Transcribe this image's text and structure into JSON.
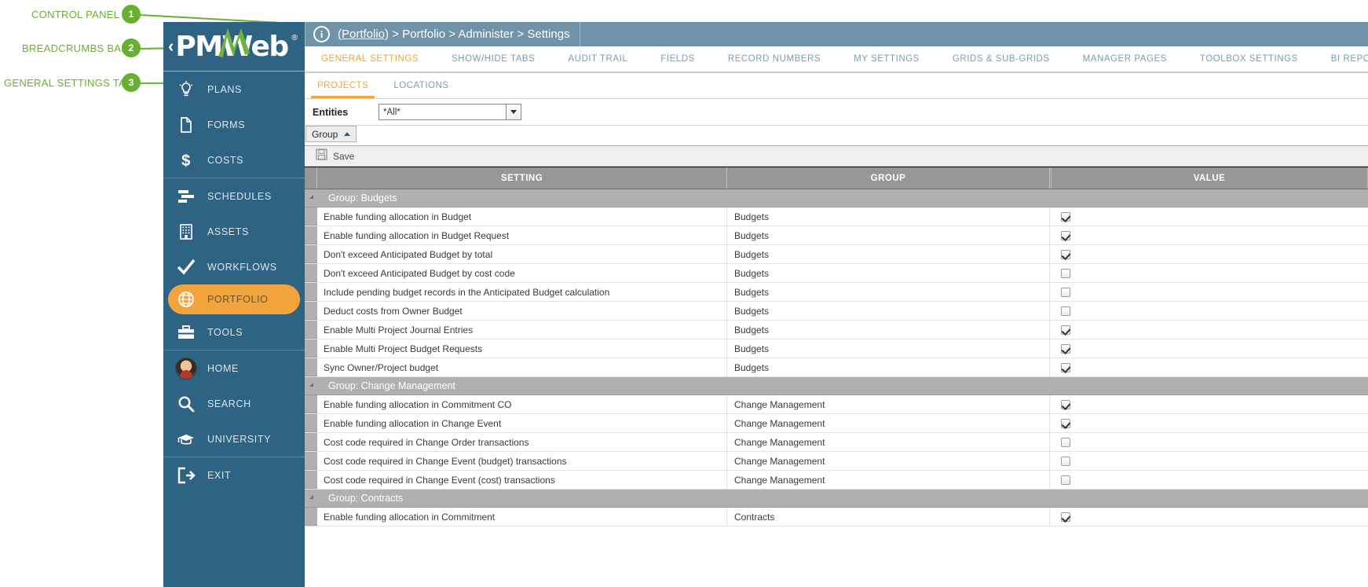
{
  "annotations": [
    {
      "num": "1",
      "label": "CONTROL PANEL"
    },
    {
      "num": "2",
      "label": "BREADCRUMBS BAR"
    },
    {
      "num": "3",
      "label": "GENERAL SETTINGS TAB"
    }
  ],
  "colors": {
    "sidebar": "#2f6384",
    "accent": "#f2a33c",
    "topbar": "#6f93a8",
    "annotation": "#68b130",
    "grid_header": "#979797",
    "group_row": "#b0b0b0"
  },
  "sidebar": {
    "logo": {
      "text": "PMWeb",
      "chevron": "‹",
      "registered": "®"
    },
    "groups": [
      {
        "items": [
          {
            "label": "PLANS",
            "icon": "lightbulb-icon",
            "active": false
          },
          {
            "label": "FORMS",
            "icon": "document-icon",
            "active": false
          },
          {
            "label": "COSTS",
            "icon": "dollar-icon",
            "active": false
          }
        ]
      },
      {
        "items": [
          {
            "label": "SCHEDULES",
            "icon": "gantt-icon",
            "active": false
          },
          {
            "label": "ASSETS",
            "icon": "building-icon",
            "active": false
          },
          {
            "label": "WORKFLOWS",
            "icon": "checkmark-icon",
            "active": false
          },
          {
            "label": "PORTFOLIO",
            "icon": "globe-icon",
            "active": true
          },
          {
            "label": "TOOLS",
            "icon": "toolbox-icon",
            "active": false
          }
        ]
      },
      {
        "items": [
          {
            "label": "HOME",
            "icon": "avatar-icon",
            "active": false
          },
          {
            "label": "SEARCH",
            "icon": "search-icon",
            "active": false
          },
          {
            "label": "UNIVERSITY",
            "icon": "graduation-cap-icon",
            "active": false
          }
        ]
      },
      {
        "items": [
          {
            "label": "EXIT",
            "icon": "exit-icon",
            "active": false
          }
        ]
      }
    ]
  },
  "header": {
    "info_icon": "i",
    "breadcrumb_link": "(Portfolio)",
    "breadcrumb_rest": " > Portfolio > Administer > Settings"
  },
  "tabs": [
    {
      "label": "GENERAL SETTINGS",
      "active": true
    },
    {
      "label": "SHOW/HIDE TABS",
      "active": false
    },
    {
      "label": "AUDIT TRAIL",
      "active": false
    },
    {
      "label": "FIELDS",
      "active": false
    },
    {
      "label": "RECORD NUMBERS",
      "active": false
    },
    {
      "label": "MY SETTINGS",
      "active": false
    },
    {
      "label": "GRIDS & SUB-GRIDS",
      "active": false
    },
    {
      "label": "MANAGER PAGES",
      "active": false
    },
    {
      "label": "TOOLBOX SETTINGS",
      "active": false
    },
    {
      "label": "BI REPORTING",
      "active": false
    }
  ],
  "subtabs": [
    {
      "label": "PROJECTS",
      "active": true
    },
    {
      "label": "LOCATIONS",
      "active": false
    }
  ],
  "filter": {
    "entities_label": "Entities",
    "entities_value": "*All*",
    "entities_placeholder": "*All*"
  },
  "group_button": {
    "label": "Group"
  },
  "toolbar": {
    "save_label": "Save",
    "save_icon": "save-disk-icon"
  },
  "grid": {
    "columns": [
      "SETTING",
      "GROUP",
      "VALUE"
    ],
    "groups": [
      {
        "title": "Group: Budgets",
        "rows": [
          {
            "setting": "Enable funding allocation in Budget",
            "group": "Budgets",
            "value": true
          },
          {
            "setting": "Enable funding allocation in Budget Request",
            "group": "Budgets",
            "value": true
          },
          {
            "setting": "Don't exceed Anticipated Budget by total",
            "group": "Budgets",
            "value": true
          },
          {
            "setting": "Don't exceed Anticipated Budget by cost code",
            "group": "Budgets",
            "value": false
          },
          {
            "setting": "Include pending budget records in the Anticipated Budget calculation",
            "group": "Budgets",
            "value": false
          },
          {
            "setting": "Deduct costs from Owner Budget",
            "group": "Budgets",
            "value": false
          },
          {
            "setting": "Enable Multi Project Journal Entries",
            "group": "Budgets",
            "value": true
          },
          {
            "setting": "Enable Multi Project Budget Requests",
            "group": "Budgets",
            "value": true
          },
          {
            "setting": "Sync Owner/Project budget",
            "group": "Budgets",
            "value": true
          }
        ]
      },
      {
        "title": "Group: Change Management",
        "rows": [
          {
            "setting": "Enable funding allocation in Commitment CO",
            "group": "Change Management",
            "value": true
          },
          {
            "setting": "Enable funding allocation in Change Event",
            "group": "Change Management",
            "value": true
          },
          {
            "setting": "Cost code required in Change Order transactions",
            "group": "Change Management",
            "value": false
          },
          {
            "setting": "Cost code required in Change Event (budget) transactions",
            "group": "Change Management",
            "value": false
          },
          {
            "setting": "Cost code required in Change Event (cost) transactions",
            "group": "Change Management",
            "value": false
          }
        ]
      },
      {
        "title": "Group: Contracts",
        "rows": [
          {
            "setting": "Enable funding allocation in Commitment",
            "group": "Contracts",
            "value": true
          }
        ]
      }
    ]
  }
}
